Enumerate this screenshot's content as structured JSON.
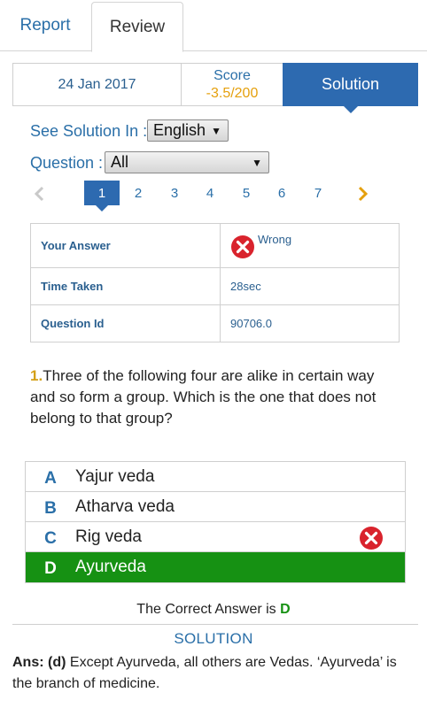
{
  "tabs": {
    "report": "Report",
    "review": "Review"
  },
  "summary": {
    "date": "24 Jan 2017",
    "score_label": "Score",
    "score_value": "-3.5/200",
    "solution_label": "Solution"
  },
  "language": {
    "label": "See Solution In :",
    "selected": "English"
  },
  "question_filter": {
    "label": "Question :",
    "selected": "All"
  },
  "pager": {
    "pages": [
      "1",
      "2",
      "3",
      "4",
      "5",
      "6",
      "7"
    ],
    "active": "1"
  },
  "info": {
    "your_answer_label": "Your Answer",
    "your_answer_value": "Wrong",
    "time_taken_label": "Time Taken",
    "time_taken_value": "28sec",
    "question_id_label": "Question Id",
    "question_id_value": "90706.0"
  },
  "question": {
    "number": "1.",
    "text": "Three of the following four are alike in certain way and so form a group. Which is the one that does not belong to that group?"
  },
  "options": [
    {
      "letter": "A",
      "text": "Yajur veda"
    },
    {
      "letter": "B",
      "text": "Atharva veda"
    },
    {
      "letter": "C",
      "text": "Rig veda"
    },
    {
      "letter": "D",
      "text": "Ayurveda"
    }
  ],
  "correct_answer": {
    "prefix": "The Correct Answer is",
    "letter": "D"
  },
  "solution": {
    "title": "SOLUTION",
    "ans_prefix": "Ans: (d)",
    "explanation": "Except Ayurveda, all others are Vedas. ‘Ayurveda’ is the branch of medicine."
  },
  "colors": {
    "accent": "#2d6ab0",
    "correct": "#169113",
    "wrong": "#d9232d",
    "score": "#e5a00d"
  }
}
